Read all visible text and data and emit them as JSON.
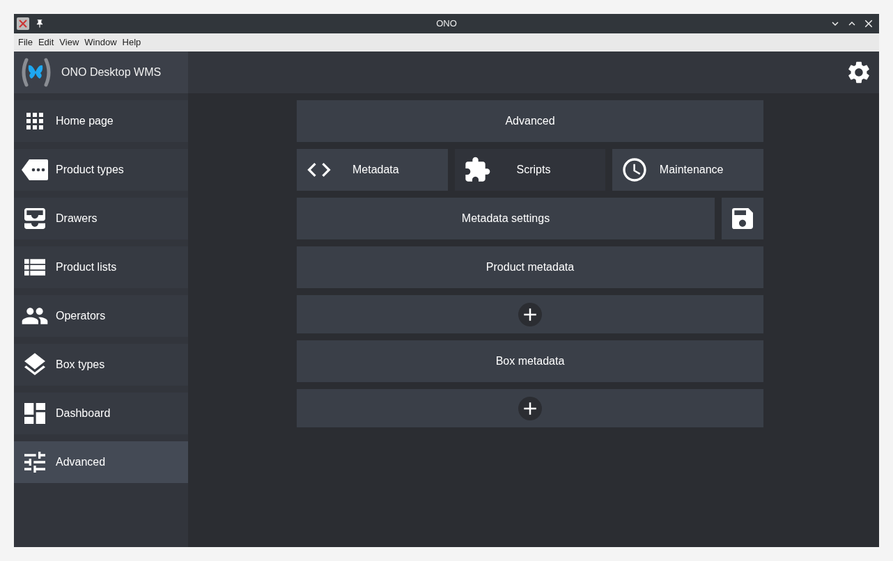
{
  "window": {
    "title": "ONO"
  },
  "menu": [
    "File",
    "Edit",
    "View",
    "Window",
    "Help"
  ],
  "app": {
    "title": "ONO Desktop WMS"
  },
  "sidebar": {
    "items": [
      {
        "label": "Home page",
        "selected": false
      },
      {
        "label": "Product types",
        "selected": false
      },
      {
        "label": "Drawers",
        "selected": false
      },
      {
        "label": "Product lists",
        "selected": false
      },
      {
        "label": "Operators",
        "selected": false
      },
      {
        "label": "Box types",
        "selected": false
      },
      {
        "label": "Dashboard",
        "selected": false
      },
      {
        "label": "Advanced",
        "selected": true
      }
    ]
  },
  "panel": {
    "title": "Advanced",
    "tabs": [
      {
        "label": "Metadata",
        "selected": false
      },
      {
        "label": "Scripts",
        "selected": true
      },
      {
        "label": "Maintenance",
        "selected": false
      }
    ],
    "settings_title": "Metadata settings",
    "sections": [
      {
        "title": "Product metadata"
      },
      {
        "title": "Box metadata"
      }
    ]
  }
}
